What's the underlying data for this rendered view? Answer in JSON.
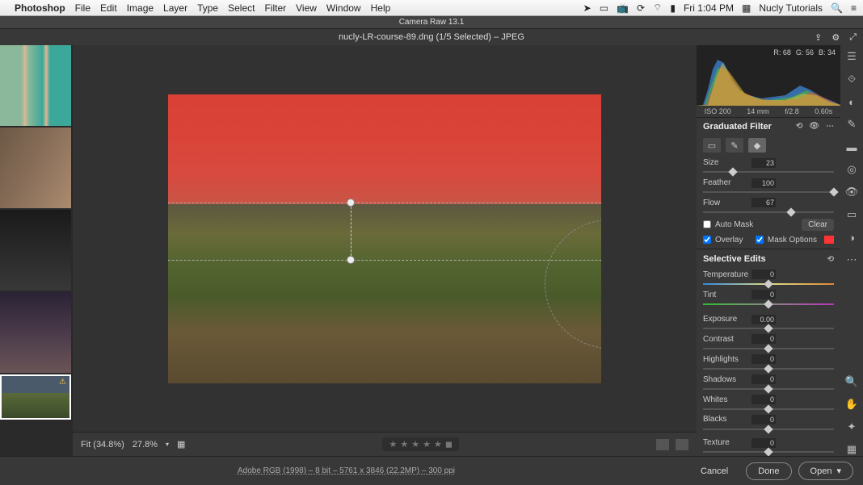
{
  "menubar": {
    "app": "Photoshop",
    "items": [
      "File",
      "Edit",
      "Image",
      "Layer",
      "Type",
      "Select",
      "Filter",
      "View",
      "Window",
      "Help"
    ],
    "clock": "Fri 1:04 PM",
    "user": "Nucly Tutorials"
  },
  "window": {
    "title": "Camera Raw 13.1",
    "subtitle": "nucly-LR-course-89.dng (1/5 Selected)  –  JPEG"
  },
  "canvas": {
    "fit_label": "Fit (34.8%)",
    "zoom": "27.8%"
  },
  "readout": {
    "r_label": "R:",
    "r": "68",
    "g_label": "G:",
    "g": "56",
    "b_label": "B:",
    "b": "34"
  },
  "exif": {
    "iso": "ISO 200",
    "focal": "14 mm",
    "aperture": "f/2.8",
    "shutter": "0.60s"
  },
  "panel": {
    "title": "Graduated Filter",
    "size_label": "Size",
    "size": "23",
    "feather_label": "Feather",
    "feather": "100",
    "flow_label": "Flow",
    "flow": "67",
    "auto_mask": "Auto Mask",
    "clear": "Clear",
    "overlay": "Overlay",
    "mask_options": "Mask Options"
  },
  "edits": {
    "title": "Selective Edits",
    "temperature_label": "Temperature",
    "temperature": "0",
    "tint_label": "Tint",
    "tint": "0",
    "exposure_label": "Exposure",
    "exposure": "0.00",
    "contrast_label": "Contrast",
    "contrast": "0",
    "highlights_label": "Highlights",
    "highlights": "0",
    "shadows_label": "Shadows",
    "shadows": "0",
    "whites_label": "Whites",
    "whites": "0",
    "blacks_label": "Blacks",
    "blacks": "0",
    "texture_label": "Texture",
    "texture": "0"
  },
  "footer": {
    "meta": "Adobe RGB (1998) – 8 bit – 5761 x 3846 (22.2MP) – 300 ppi",
    "cancel": "Cancel",
    "done": "Done",
    "open": "Open"
  }
}
